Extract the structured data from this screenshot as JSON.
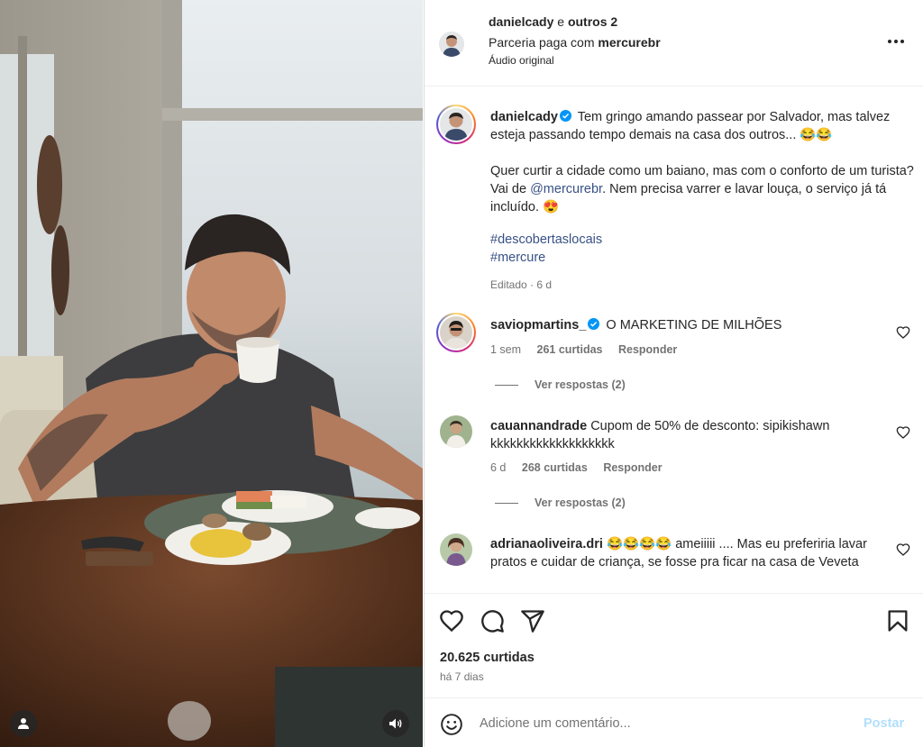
{
  "post": {
    "header": {
      "username": "danielcady",
      "coauthors_connector": "e",
      "coauthors": "outros 2",
      "partnership_prefix": "Parceria paga com",
      "partner": "mercurebr",
      "audio": "Áudio original"
    },
    "caption": {
      "username": "danielcady",
      "text1": "Tem gringo amando passear por Salvador, mas talvez esteja passando tempo demais na casa dos outros... 😂😂",
      "text2_a": "Quer curtir a cidade como um baiano, mas com o conforto de um turista? Vai de ",
      "mention": "@mercurebr",
      "text2_b": ". Nem precisa varrer e lavar louça, o serviço já tá incluído. 😍",
      "hashtag1": "#descobertaslocais",
      "hashtag2": "#mercure",
      "meta": "Editado · 6 d"
    },
    "comments": [
      {
        "username": "saviopmartins_",
        "text": "O MARKETING DE MILHÕES",
        "time": "1 sem",
        "likes": "261 curtidas",
        "reply": "Responder",
        "view_replies": "Ver respostas (2)"
      },
      {
        "username": "cauannandrade",
        "text": "Cupom de 50% de desconto: sipikishawn kkkkkkkkkkkkkkkkkkk",
        "time": "6 d",
        "likes": "268 curtidas",
        "reply": "Responder",
        "view_replies": "Ver respostas (2)"
      },
      {
        "username": "adrianaoliveira.dri",
        "text": "😂😂😂😂 ameiiiii .... Mas eu preferiria lavar pratos e cuidar de criança, se fosse pra ficar na casa de Veveta"
      }
    ],
    "likes": "20.625 curtidas",
    "date": "há 7 dias",
    "composer": {
      "placeholder": "Adicione um comentário...",
      "post_label": "Postar"
    }
  },
  "icons": {
    "more": "more-horizontal-icon",
    "verified": "verified-badge-icon",
    "like": "heart-icon",
    "comment": "comment-icon",
    "share": "share-icon",
    "save": "bookmark-icon",
    "emoji": "emoji-icon",
    "tag": "user-tag-icon",
    "audio": "speaker-icon"
  },
  "colors": {
    "link": "#385185",
    "secondary_text": "#737373",
    "verified": "#0095f6",
    "post_button_disabled": "#b2dffc"
  }
}
